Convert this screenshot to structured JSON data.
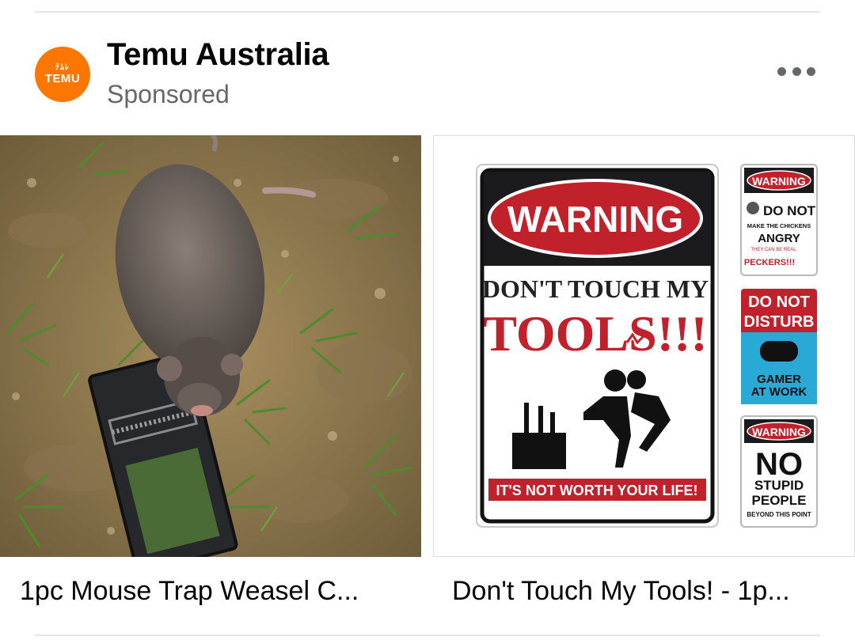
{
  "post": {
    "page_name": "Temu Australia",
    "sponsored_label": "Sponsored",
    "avatar_logo": {
      "line1": "ﾃﾑﾚ",
      "line2": "TEMU"
    },
    "more_icon": "more-horizontal-icon"
  },
  "colors": {
    "brand": "#fb7701",
    "text": "#050505",
    "secondary": "#65676b",
    "divider": "#e4e6eb"
  },
  "carousel": [
    {
      "caption": "1pc Mouse Trap Weasel C...",
      "image": "rat-in-mouse-trap-on-grass"
    },
    {
      "caption": "Don't Touch My Tools! - 1p...",
      "image": "warning-signs-product-photo",
      "signs": {
        "main": {
          "header": "WARNING",
          "line1": "DON'T TOUCH MY",
          "line2": "TOOLS!!!",
          "footer": "IT'S NOT WORTH YOUR LIFE!"
        },
        "chickens": {
          "header": "WARNING",
          "line1": "DO NOT",
          "line2": "MAKE THE CHICKENS",
          "line3": "ANGRY",
          "line4": "THEY CAN BE REAL",
          "line5": "PECKERS!!!"
        },
        "gamer": {
          "line1": "DO NOT",
          "line2": "DISTURB",
          "line3": "GAMER",
          "line4": "AT WORK"
        },
        "stupid": {
          "header": "WARNING",
          "line1": "NO",
          "line2": "STUPID",
          "line3": "PEOPLE",
          "line4": "BEYOND THIS POINT"
        }
      }
    }
  ]
}
